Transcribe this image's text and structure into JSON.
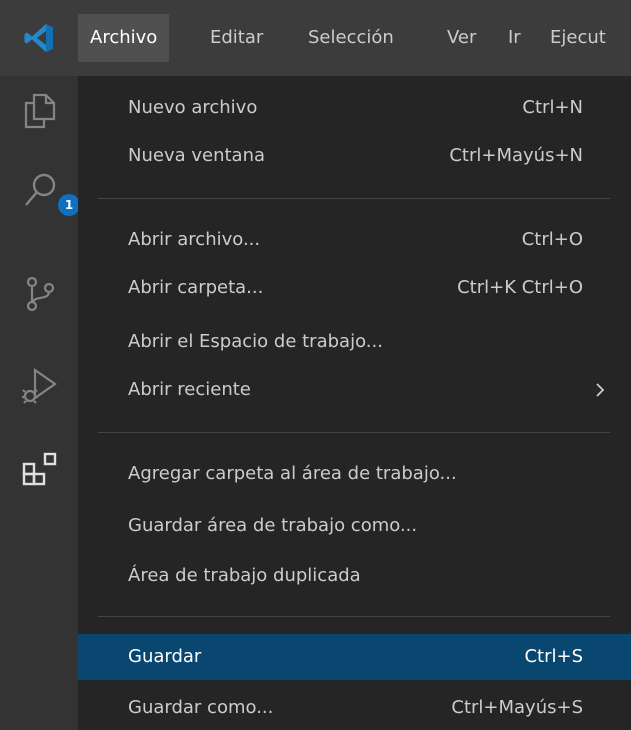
{
  "titlebar": {
    "menus": [
      "Archivo",
      "Editar",
      "Selección",
      "Ver",
      "Ir",
      "Ejecut"
    ]
  },
  "activity_bar": {
    "explorer_badge": "1"
  },
  "file_menu": {
    "items": [
      {
        "label": "Nuevo archivo",
        "shortcut": "Ctrl+N"
      },
      {
        "label": "Nueva ventana",
        "shortcut": "Ctrl+Mayús+N"
      },
      {
        "label": "Abrir archivo...",
        "shortcut": "Ctrl+O"
      },
      {
        "label": "Abrir carpeta...",
        "shortcut": "Ctrl+K Ctrl+O"
      },
      {
        "label": "Abrir el Espacio de trabajo...",
        "shortcut": ""
      },
      {
        "label": "Abrir reciente",
        "shortcut": "",
        "submenu_arrow": "›"
      },
      {
        "label": "Agregar carpeta al área de trabajo...",
        "shortcut": ""
      },
      {
        "label": "Guardar área de trabajo como...",
        "shortcut": ""
      },
      {
        "label": "Área de trabajo duplicada",
        "shortcut": ""
      },
      {
        "label": "Guardar",
        "shortcut": "Ctrl+S"
      },
      {
        "label": "Guardar como...",
        "shortcut": "Ctrl+Mayús+S"
      }
    ]
  },
  "colors": {
    "titlebar_bg": "#3c3c3c",
    "activity_bar_bg": "#333333",
    "menu_bg": "#252526",
    "highlight_bg": "#094771",
    "accent_blue": "#0e70c0",
    "text": "#cccccc"
  }
}
